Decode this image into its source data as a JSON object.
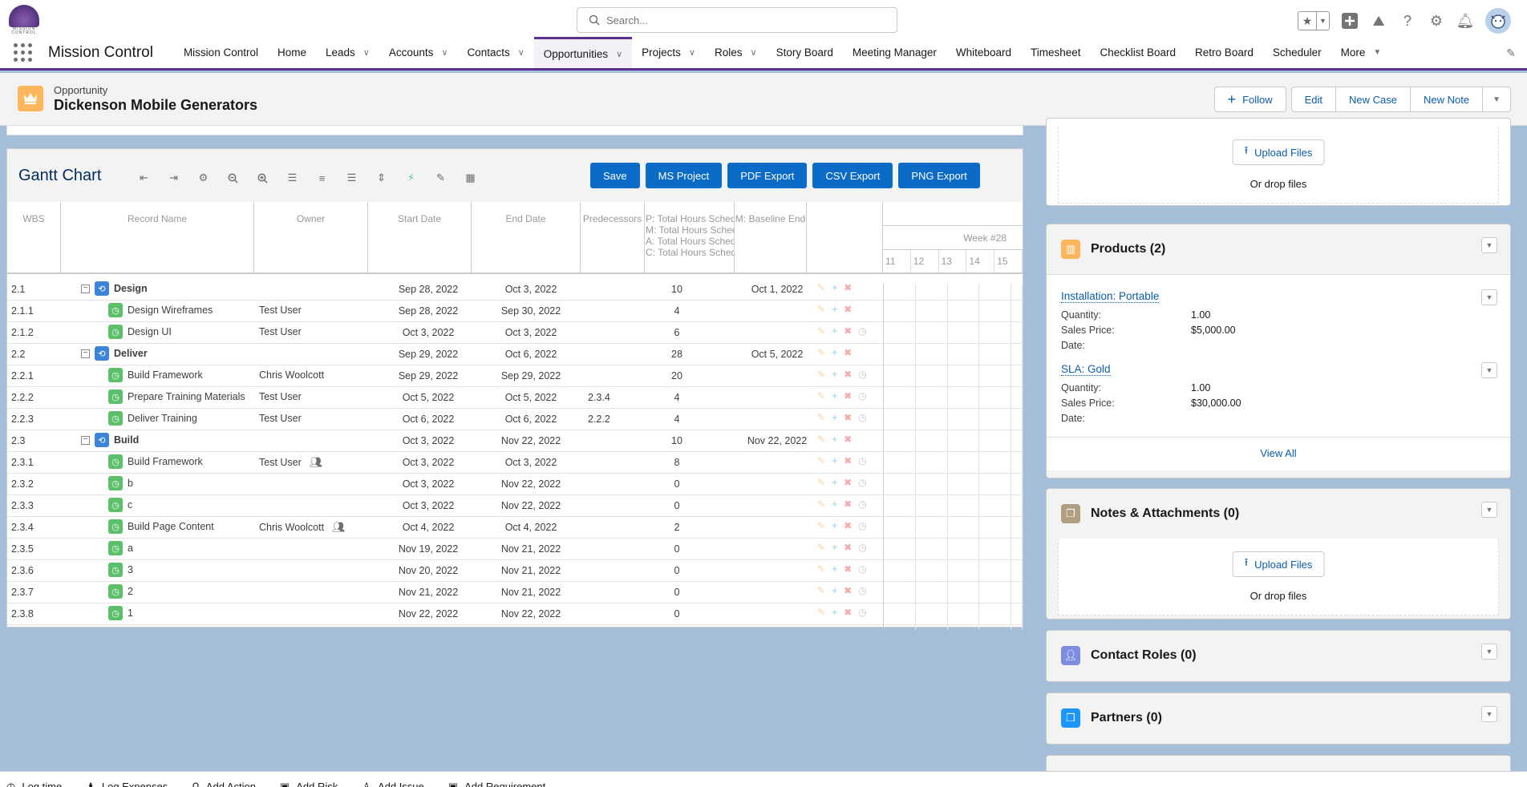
{
  "header": {
    "logo_text": "MISSION CONTROL",
    "search_placeholder": "Search...",
    "icons": [
      "favorites-star-icon",
      "favorites-dropdown-icon",
      "global-add-icon",
      "trailhead-icon",
      "help-icon",
      "setup-gear-icon",
      "notifications-bell-icon",
      "user-avatar"
    ]
  },
  "nav": {
    "app_name": "Mission Control",
    "items": [
      {
        "label": "Mission Control",
        "has_menu": false
      },
      {
        "label": "Home",
        "has_menu": false
      },
      {
        "label": "Leads",
        "has_menu": true
      },
      {
        "label": "Accounts",
        "has_menu": true
      },
      {
        "label": "Contacts",
        "has_menu": true
      },
      {
        "label": "Opportunities",
        "has_menu": true,
        "active": true
      },
      {
        "label": "Projects",
        "has_menu": true
      },
      {
        "label": "Roles",
        "has_menu": true
      },
      {
        "label": "Story Board",
        "has_menu": false
      },
      {
        "label": "Meeting Manager",
        "has_menu": false
      },
      {
        "label": "Whiteboard",
        "has_menu": false
      },
      {
        "label": "Timesheet",
        "has_menu": false
      },
      {
        "label": "Checklist Board",
        "has_menu": false
      },
      {
        "label": "Retro Board",
        "has_menu": false
      },
      {
        "label": "Scheduler",
        "has_menu": false
      }
    ],
    "more_label": "More"
  },
  "record": {
    "type": "Opportunity",
    "name": "Dickenson Mobile Generators",
    "actions": {
      "follow": "Follow",
      "edit": "Edit",
      "new_case": "New Case",
      "new_note": "New Note"
    }
  },
  "gantt": {
    "title": "Gantt Chart",
    "toolbar_icons": [
      "indent-left-icon",
      "indent-right-icon",
      "settings-gear-icon",
      "zoom-out-icon",
      "zoom-in-icon",
      "collapse-list-icon",
      "list-icon",
      "align-center-icon",
      "expand-vertical-icon",
      "lightning-icon",
      "pencil-icon",
      "calendar-icon"
    ],
    "buttons": {
      "save": "Save",
      "ms_project": "MS Project",
      "pdf": "PDF Export",
      "csv": "CSV Export",
      "png": "PNG Export"
    },
    "columns": {
      "wbs": "WBS",
      "name": "Record Name",
      "owner": "Owner",
      "start": "Start Date",
      "end": "End Date",
      "pred": "Predecessors",
      "hours": [
        "P: Total Hours Sched",
        "M: Total Hours Sched",
        "A: Total Hours Sched",
        "C: Total Hours Sched"
      ],
      "baseline": "M: Baseline End"
    },
    "timeline": {
      "week": "Week #28",
      "days": [
        "11",
        "12",
        "13",
        "14",
        "15"
      ]
    },
    "rows": [
      {
        "wbs": "2.1",
        "name": "Design",
        "type": "parent",
        "owner": "",
        "start": "Sep 28, 2022",
        "end": "Oct 3, 2022",
        "pred": "",
        "hours": "10",
        "baseline": "Oct 1, 2022",
        "clock": false,
        "assign": false
      },
      {
        "wbs": "2.1.1",
        "name": "Design Wireframes",
        "type": "child",
        "owner": "Test User",
        "start": "Sep 28, 2022",
        "end": "Sep 30, 2022",
        "pred": "",
        "hours": "4",
        "baseline": "",
        "clock": false,
        "assign": false
      },
      {
        "wbs": "2.1.2",
        "name": "Design UI",
        "type": "child",
        "owner": "Test User",
        "start": "Oct 3, 2022",
        "end": "Oct 3, 2022",
        "pred": "",
        "hours": "6",
        "baseline": "",
        "clock": true,
        "assign": false
      },
      {
        "wbs": "2.2",
        "name": "Deliver",
        "type": "parent",
        "owner": "",
        "start": "Sep 29, 2022",
        "end": "Oct 6, 2022",
        "pred": "",
        "hours": "28",
        "baseline": "Oct 5, 2022",
        "clock": false,
        "assign": false
      },
      {
        "wbs": "2.2.1",
        "name": "Build Framework",
        "type": "child",
        "owner": "Chris Woolcott",
        "start": "Sep 29, 2022",
        "end": "Sep 29, 2022",
        "pred": "",
        "hours": "20",
        "baseline": "",
        "clock": true,
        "assign": false
      },
      {
        "wbs": "2.2.2",
        "name": "Prepare Training Materials",
        "type": "child",
        "owner": "Test User",
        "start": "Oct 5, 2022",
        "end": "Oct 5, 2022",
        "pred": "2.3.4",
        "hours": "4",
        "baseline": "",
        "clock": true,
        "assign": false
      },
      {
        "wbs": "2.2.3",
        "name": "Deliver Training",
        "type": "child",
        "owner": "Test User",
        "start": "Oct 6, 2022",
        "end": "Oct 6, 2022",
        "pred": "2.2.2",
        "hours": "4",
        "baseline": "",
        "clock": true,
        "assign": false
      },
      {
        "wbs": "2.3",
        "name": "Build",
        "type": "parent",
        "owner": "",
        "start": "Oct 3, 2022",
        "end": "Nov 22, 2022",
        "pred": "",
        "hours": "10",
        "baseline": "Nov 22, 2022",
        "clock": false,
        "assign": false
      },
      {
        "wbs": "2.3.1",
        "name": "Build Framework",
        "type": "child",
        "owner": "Test User",
        "start": "Oct 3, 2022",
        "end": "Oct 3, 2022",
        "pred": "",
        "hours": "8",
        "baseline": "",
        "clock": true,
        "assign": true
      },
      {
        "wbs": "2.3.2",
        "name": "b",
        "type": "child",
        "owner": "",
        "start": "Oct 3, 2022",
        "end": "Nov 22, 2022",
        "pred": "",
        "hours": "0",
        "baseline": "",
        "clock": true,
        "assign": false
      },
      {
        "wbs": "2.3.3",
        "name": "c",
        "type": "child",
        "owner": "",
        "start": "Oct 3, 2022",
        "end": "Nov 22, 2022",
        "pred": "",
        "hours": "0",
        "baseline": "",
        "clock": true,
        "assign": false
      },
      {
        "wbs": "2.3.4",
        "name": "Build Page Content",
        "type": "child",
        "owner": "Chris Woolcott",
        "start": "Oct 4, 2022",
        "end": "Oct 4, 2022",
        "pred": "",
        "hours": "2",
        "baseline": "",
        "clock": true,
        "assign": true
      },
      {
        "wbs": "2.3.5",
        "name": "a",
        "type": "child",
        "owner": "",
        "start": "Nov 19, 2022",
        "end": "Nov 21, 2022",
        "pred": "",
        "hours": "0",
        "baseline": "",
        "clock": true,
        "assign": false
      },
      {
        "wbs": "2.3.6",
        "name": "3",
        "type": "child",
        "owner": "",
        "start": "Nov 20, 2022",
        "end": "Nov 21, 2022",
        "pred": "",
        "hours": "0",
        "baseline": "",
        "clock": true,
        "assign": false
      },
      {
        "wbs": "2.3.7",
        "name": "2",
        "type": "child",
        "owner": "",
        "start": "Nov 21, 2022",
        "end": "Nov 21, 2022",
        "pred": "",
        "hours": "0",
        "baseline": "",
        "clock": true,
        "assign": false
      },
      {
        "wbs": "2.3.8",
        "name": "1",
        "type": "child",
        "owner": "",
        "start": "Nov 22, 2022",
        "end": "Nov 22, 2022",
        "pred": "",
        "hours": "0",
        "baseline": "",
        "clock": true,
        "assign": false
      }
    ]
  },
  "sidebar": {
    "files": {
      "upload": "Upload Files",
      "drop": "Or drop files"
    },
    "products": {
      "title": "Products (2)",
      "items": [
        {
          "name": "Installation: Portable",
          "quantity_label": "Quantity:",
          "quantity": "1.00",
          "price_label": "Sales Price:",
          "price": "$5,000.00",
          "date_label": "Date:",
          "date": ""
        },
        {
          "name": "SLA: Gold",
          "quantity_label": "Quantity:",
          "quantity": "1.00",
          "price_label": "Sales Price:",
          "price": "$30,000.00",
          "date_label": "Date:",
          "date": ""
        }
      ],
      "view_all": "View All"
    },
    "notes": {
      "title": "Notes & Attachments (0)",
      "upload": "Upload Files",
      "drop": "Or drop files"
    },
    "contact_roles": {
      "title": "Contact Roles (0)"
    },
    "partners": {
      "title": "Partners (0)"
    },
    "colors": {
      "products": "#ffb75d",
      "notes": "#b19f81",
      "contact_roles": "#7f8de1",
      "partners": "#1b96ff"
    }
  },
  "utility_bar": [
    "Log time",
    "Log Expenses",
    "Add Action",
    "Add Risk",
    "Add Issue",
    "Add Requirement"
  ]
}
